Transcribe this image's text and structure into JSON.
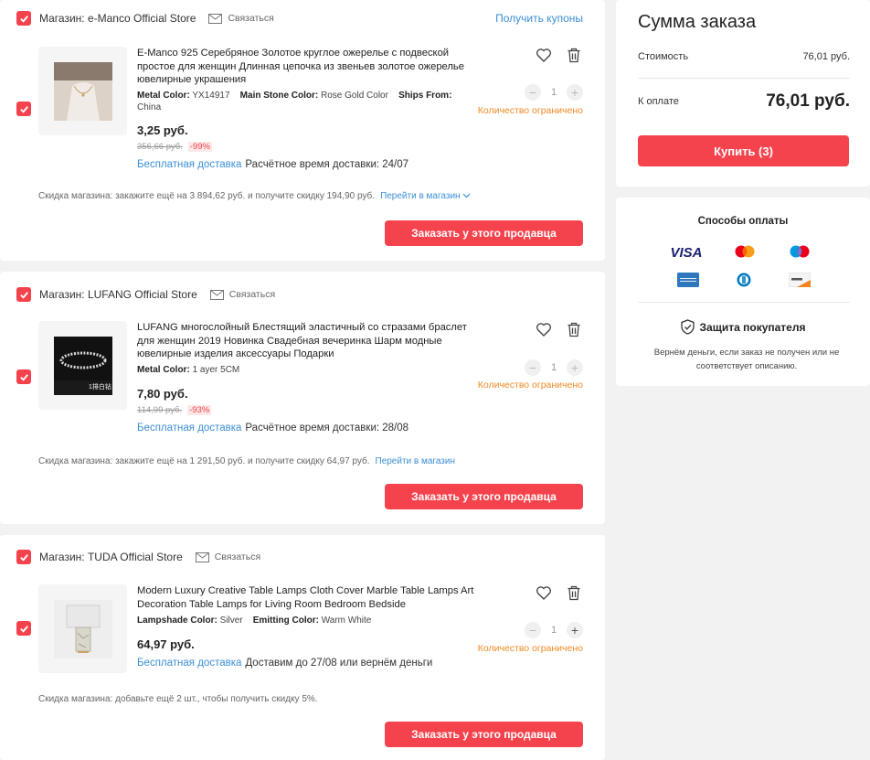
{
  "stores": [
    {
      "name": "Магазин: e-Manco Official Store",
      "contact": "Связаться",
      "coupons": "Получить купоны",
      "item": {
        "title": "E-Manco 925 Серебряное Золотое круглое ожерелье с подвеской простое для женщин Длинная цепочка из звеньев золотое ожерелье ювелирные украшения",
        "props": [
          {
            "key": "Metal Color:",
            "value": "YX14917"
          },
          {
            "key": "Main Stone Color:",
            "value": "Rose Gold Color"
          },
          {
            "key": "Ships From:",
            "value": "China"
          }
        ],
        "price": "3,25 руб.",
        "old_price": "356,66 руб.",
        "discount": "-99%",
        "free_shipping": "Бесплатная доставка",
        "delivery": "Расчётное время доставки: 24/07",
        "qty": "1",
        "limited": "Количество ограничено"
      },
      "store_discount": "Скидка магазина:  закажите ещё на 3 894,62 руб. и получите скидку 194,90 руб.",
      "store_link": "Перейти в магазин",
      "order_button": "Заказать у этого продавца"
    },
    {
      "name": "Магазин: LUFANG Official Store",
      "contact": "Связаться",
      "item": {
        "title": "LUFANG многослойный Блестящий эластичный со стразами браслет для женщин 2019 Новинка Свадебная вечеринка Шарм модные ювелирные изделия аксессуары Подарки",
        "props": [
          {
            "key": "Metal Color:",
            "value": "1 ayer 5CM"
          }
        ],
        "image_caption": "1排白钻",
        "price": "7,80 руб.",
        "old_price": "114,99 руб.",
        "discount": "-93%",
        "free_shipping": "Бесплатная доставка",
        "delivery": "Расчётное время доставки: 28/08",
        "qty": "1",
        "limited": "Количество ограничено"
      },
      "store_discount": "Скидка магазина:  закажите ещё на 1 291,50 руб. и получите скидку 64,97 руб.",
      "store_link": "Перейти в магазин",
      "order_button": "Заказать у этого продавца"
    },
    {
      "name": "Магазин: TUDA Official Store",
      "contact": "Связаться",
      "item": {
        "title": "Modern Luxury Creative Table Lamps Cloth Cover Marble Table Lamps Art Decoration Table Lamps for Living Room Bedroom Bedside",
        "props": [
          {
            "key": "Lampshade Color:",
            "value": "Silver"
          },
          {
            "key": "Emitting Color:",
            "value": "Warm White"
          }
        ],
        "price": "64,97 руб.",
        "free_shipping": "Бесплатная доставка",
        "delivery": "Доставим до 27/08 или вернём деньги",
        "qty": "1",
        "limited": "Количество ограничено"
      },
      "store_discount": "Скидка магазина:  добавьте ещё 2 шт., чтобы получить скидку 5%.",
      "order_button": "Заказать у этого продавца"
    }
  ],
  "summary": {
    "title": "Сумма заказа",
    "cost_label": "Стоимость",
    "cost_value": "76,01 руб.",
    "total_label": "К оплате",
    "total_value": "76,01 руб.",
    "buy_button": "Купить (3)"
  },
  "payment": {
    "title": "Способы оплаты",
    "methods": [
      "visa",
      "mastercard",
      "maestro",
      "american-express",
      "diners-club",
      "discover"
    ],
    "visa_label": "VISA",
    "protection_title": "Защита покупателя",
    "protection_text": "Вернём деньги, если заказ не получен или не соответствует описанию."
  },
  "colors": {
    "accent": "#f5434d",
    "link": "#3b8ed6",
    "warning": "#f08a24",
    "background": "#f2f2f2"
  }
}
